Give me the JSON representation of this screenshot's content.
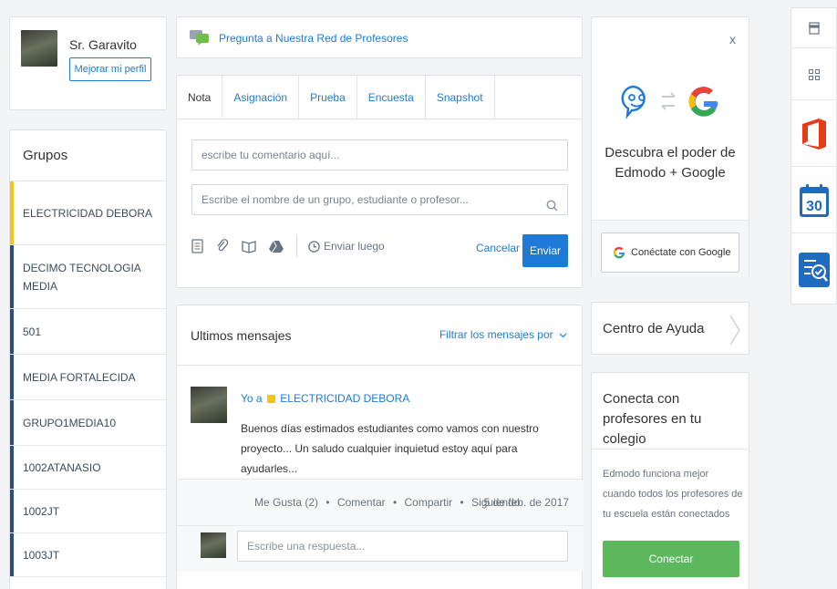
{
  "profile": {
    "name": "Sr. Garavito",
    "improve_label": "Mejorar mi perfil"
  },
  "groups": {
    "title": "Grupos",
    "items": [
      {
        "label": "ELECTRICIDAD DEBORA"
      },
      {
        "label": "DECIMO TECNOLOGIA MEDIA"
      },
      {
        "label": "501"
      },
      {
        "label": "MEDIA FORTALECIDA"
      },
      {
        "label": "GRUPO1MEDIA10"
      },
      {
        "label": "1002ATANASIO"
      },
      {
        "label": "1002JT"
      },
      {
        "label": "1003JT"
      }
    ]
  },
  "ask": {
    "label": "Pregunta a Nuestra Red de Profesores"
  },
  "composer": {
    "tabs": [
      "Nota",
      "Asignación",
      "Prueba",
      "Encuesta",
      "Snapshot"
    ],
    "comment_placeholder": "escribe tu comentario aquí...",
    "recipient_placeholder": "Escribe el nombre de un grupo, estudiante o profesor...",
    "send_later": "Enviar luego",
    "cancel": "Cancelar o",
    "send": "Enviar"
  },
  "feed": {
    "title": "Ultimos mensajes",
    "filter": "Filtrar los mensajes por",
    "post": {
      "from": "Yo a",
      "group": "ELECTRICIDAD DEBORA",
      "body": "Buenos días estimados estudiantes como vamos con nuestro proyecto... Un saludo cualquier inquietud estoy aquí para ayudarles...",
      "like": "Me Gusta (2)",
      "comment": "Comentar",
      "share": "Compartir",
      "follow": "Siguiendo",
      "date": "5 de feb. de 2017"
    },
    "reply_placeholder": "Escribe una respuesta..."
  },
  "promo": {
    "close": "x",
    "text": "Descubra el poder de Edmodo + Google",
    "google_button": "Conéctate con Google"
  },
  "help": {
    "title": "Centro de Ayuda"
  },
  "connect": {
    "title": "Conecta con profesores en tu colegio",
    "desc": "Edmodo funciona mejor cuando todos los profesores de tu escuela están conectados",
    "button": "Conectar"
  },
  "rail": {
    "calendar_day": "30"
  },
  "colors": {
    "accent": "#1e7ad6",
    "active_group": "#f5c21a",
    "group_bar": "#2a4c7c",
    "connect": "#5cb85c",
    "office": "#e63b16"
  }
}
